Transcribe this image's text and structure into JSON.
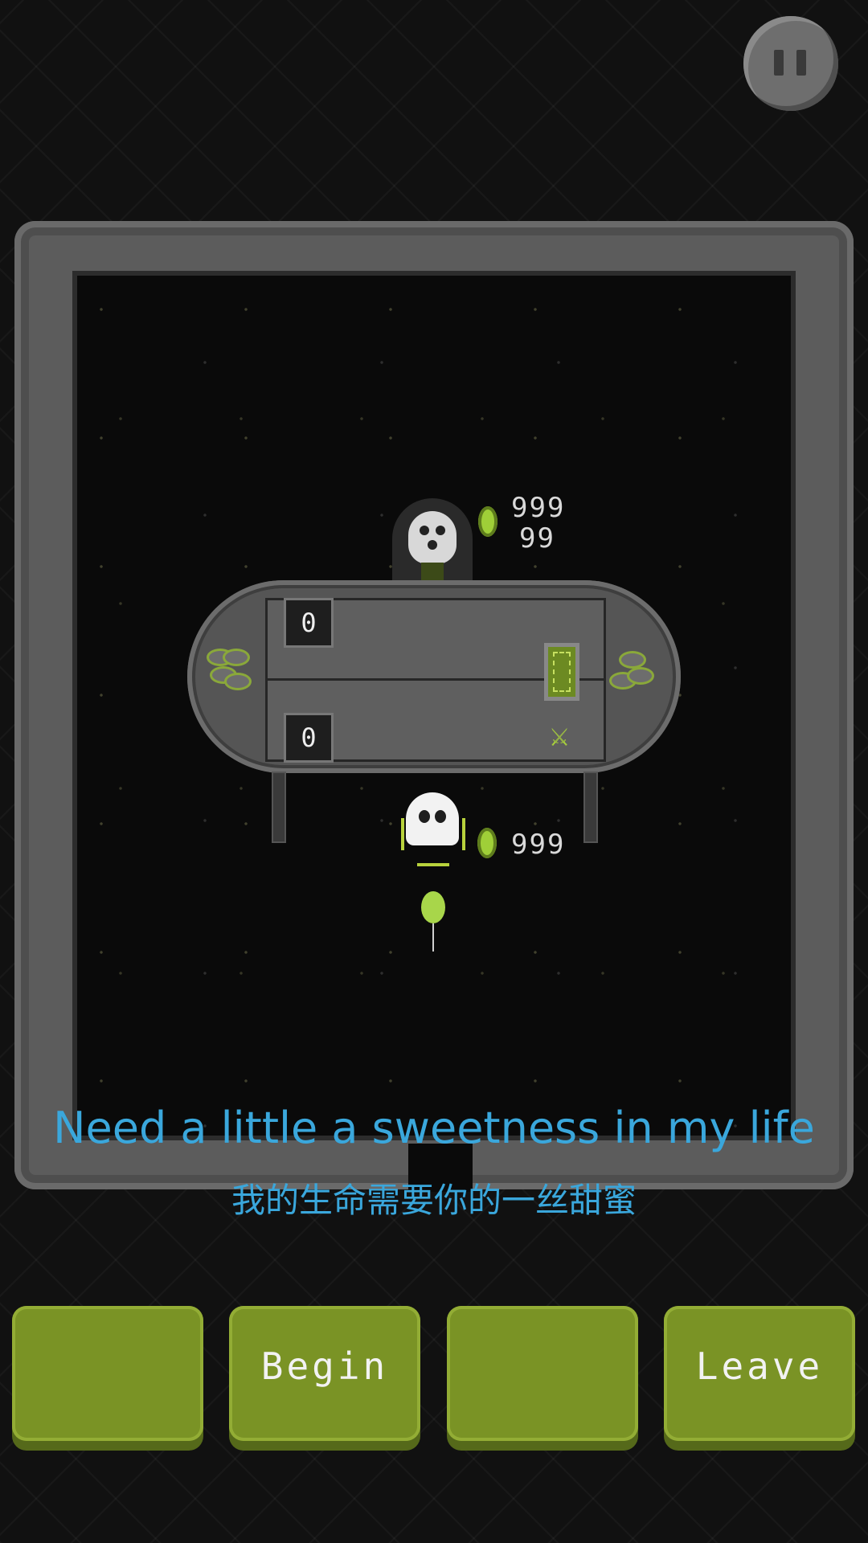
{
  "dealer": {
    "gems": "999",
    "sub_count": "99"
  },
  "table": {
    "top_score": "0",
    "bottom_score": "0"
  },
  "player": {
    "gems": "999"
  },
  "lyrics": {
    "english": "Need a little a sweetness in my life",
    "chinese": "我的生命需要你的一丝甜蜜"
  },
  "buttons": [
    {
      "label": ""
    },
    {
      "label": "Begin"
    },
    {
      "label": ""
    },
    {
      "label": "Leave"
    }
  ],
  "colors": {
    "accent_green": "#7a9325",
    "lyric_blue": "#3aa7dc"
  }
}
